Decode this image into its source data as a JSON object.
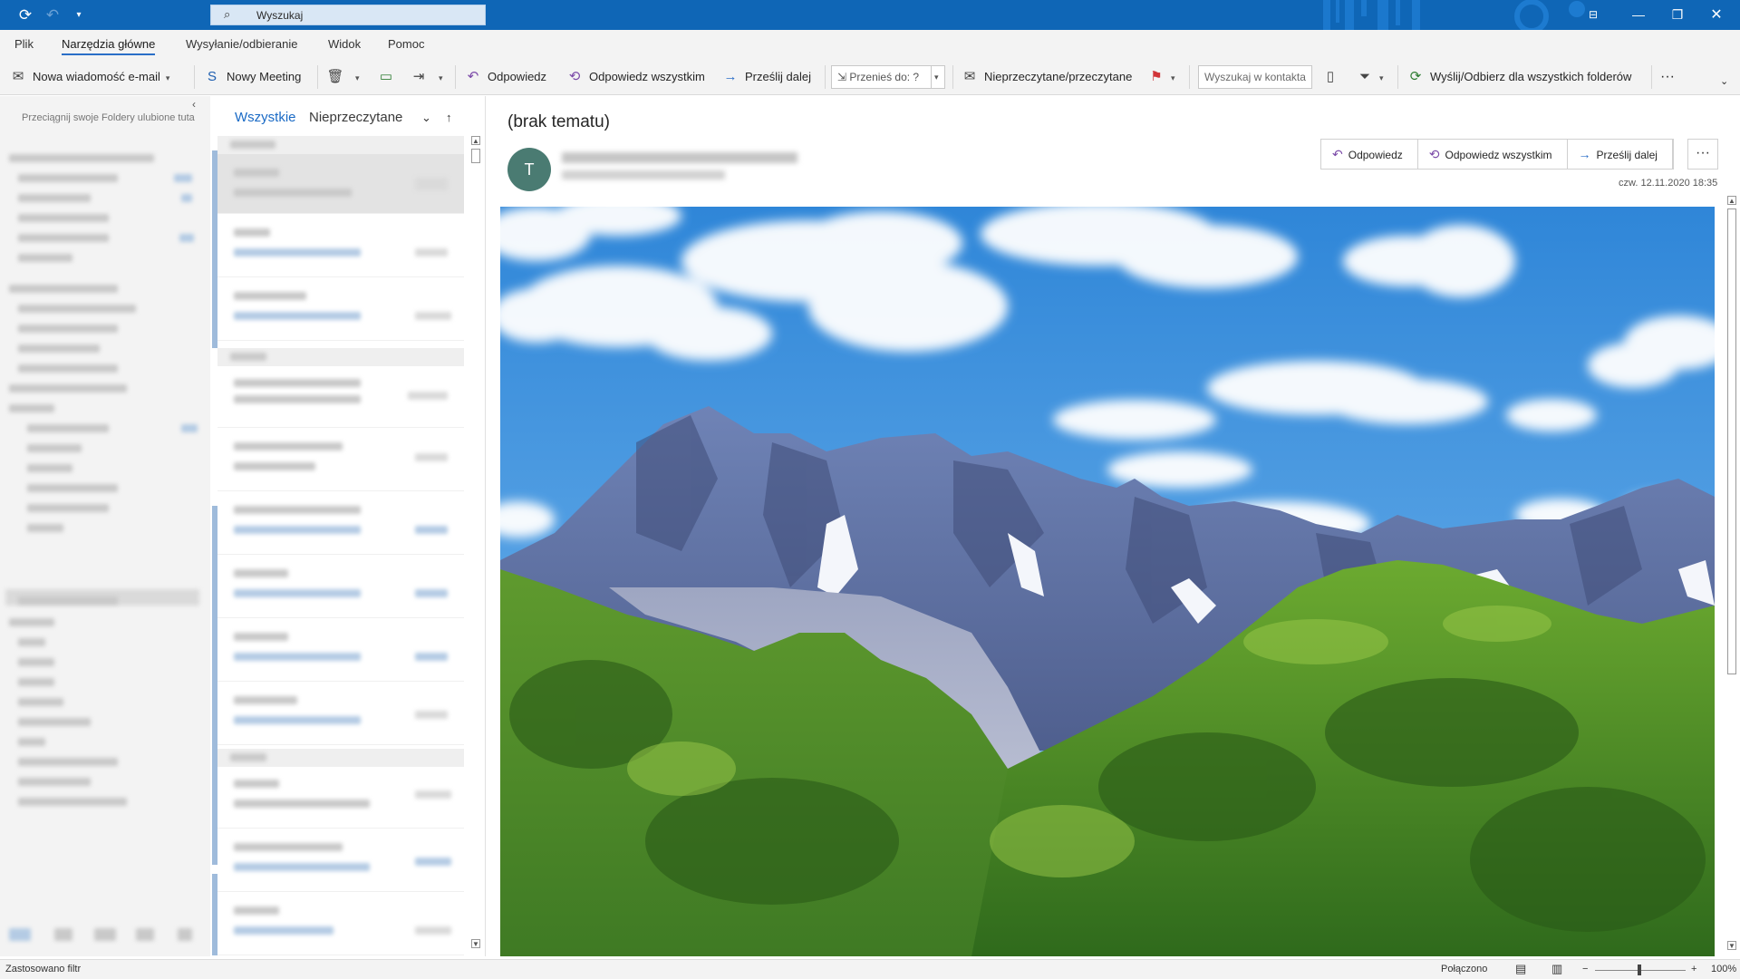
{
  "titlebar": {
    "search_placeholder": "Wyszukaj",
    "icons": [
      "sync-icon",
      "undo-icon",
      "quick-access-dropdown-icon",
      "search-icon",
      "ribbon-display-icon",
      "minimize-icon",
      "restore-icon",
      "close-icon"
    ]
  },
  "tabs": [
    "Plik",
    "Narzędzia główne",
    "Wysyłanie/odbieranie",
    "Widok",
    "Pomoc"
  ],
  "ribbon": {
    "new_email": "Nowa wiadomość e-mail",
    "new_meeting": "Nowy Meeting",
    "reply": "Odpowiedz",
    "reply_all": "Odpowiedz wszystkim",
    "forward": "Prześlij dalej",
    "move_to": "Przenieś do: ?",
    "unread_read": "Nieprzeczytane/przeczytane",
    "search_contacts": "Wyszukaj w kontakta",
    "send_receive_all": "Wyślij/Odbierz dla wszystkich folderów",
    "more": "···"
  },
  "folder_pane": {
    "favorites_hint": "Przeciągnij swoje Foldery ulubione tuta"
  },
  "message_list": {
    "tab_all": "Wszystkie",
    "tab_unread": "Nieprzeczytane"
  },
  "reading_pane": {
    "subject": "(brak tematu)",
    "avatar_initial": "T",
    "reply": "Odpowiedz",
    "reply_all": "Odpowiedz wszystkim",
    "forward": "Prześlij dalej",
    "more": "···",
    "date": "czw. 12.11.2020 18:35"
  },
  "statusbar": {
    "filter": "Zastosowano filtr",
    "connection": "Połączono",
    "zoom": "100%"
  }
}
